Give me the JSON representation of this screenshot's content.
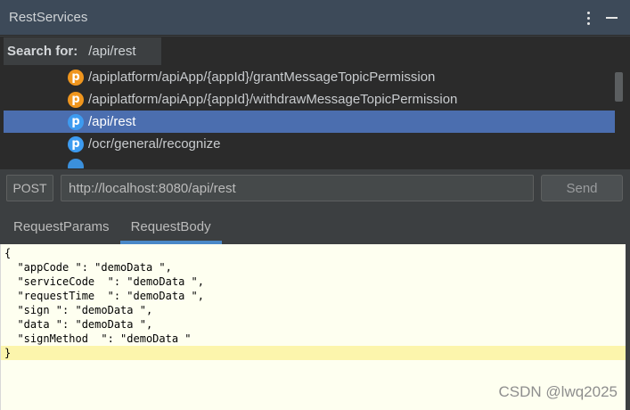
{
  "window": {
    "title": "RestServices"
  },
  "search": {
    "label": "Search for:",
    "value": "/api/rest"
  },
  "results": [
    {
      "badge": "p",
      "badge_color": "#f0961e",
      "path": "/apiplatform/apiApp/{appId}/grantMessageTopicPermission",
      "selected": false
    },
    {
      "badge": "p",
      "badge_color": "#f0961e",
      "path": "/apiplatform/apiApp/{appId}/withdrawMessageTopicPermission",
      "selected": false
    },
    {
      "badge": "p",
      "badge_color": "#3d9bf0",
      "path": "/api/rest",
      "selected": true
    },
    {
      "badge": "p",
      "badge_color": "#3d9bf0",
      "path": "/ocr/general/recognize",
      "selected": false
    }
  ],
  "request": {
    "method": "POST",
    "url": "http://localhost:8080/api/rest",
    "send_label": "Send"
  },
  "tabs": [
    {
      "label": "RequestParams",
      "active": false
    },
    {
      "label": "RequestBody",
      "active": true
    }
  ],
  "editor": {
    "lines": [
      "{",
      "  \"appCode \": \"demoData \",",
      "  \"serviceCode  \": \"demoData \",",
      "  \"requestTime  \": \"demoData \",",
      "  \"sign \": \"demoData \",",
      "  \"data \": \"demoData \",",
      "  \"signMethod  \": \"demoData \"",
      "}"
    ]
  },
  "watermark": "CSDN @lwq2025",
  "colors": {
    "selection": "#4b6eaf",
    "tab_underline": "#4a88c7",
    "editor_bg": "#fefff0",
    "current_line": "#fcf5ac"
  }
}
